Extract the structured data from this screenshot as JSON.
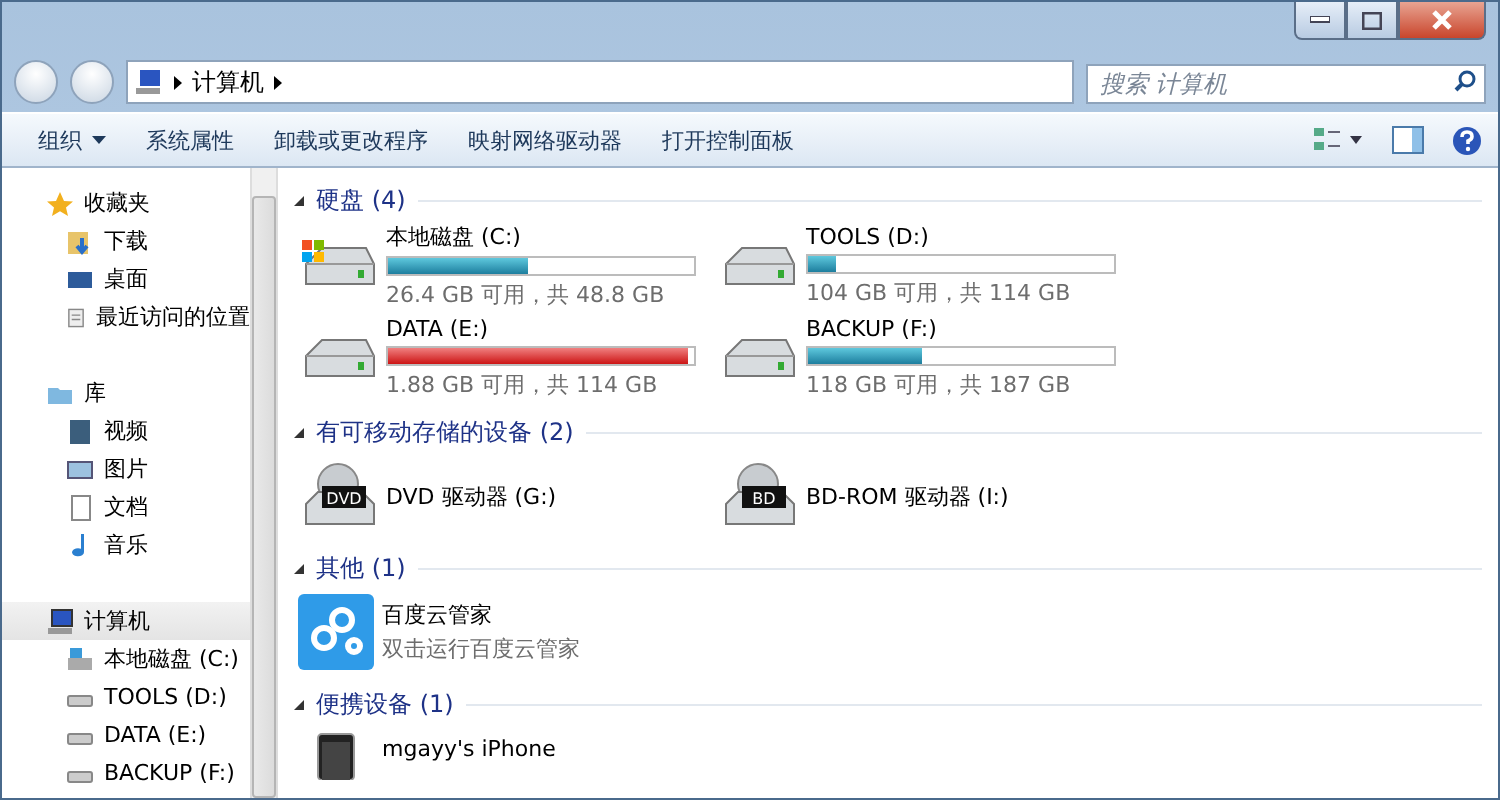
{
  "address": {
    "path": [
      {
        "label": "计算机"
      }
    ]
  },
  "search": {
    "placeholder": "搜索 计算机"
  },
  "toolbar": {
    "buttons": [
      {
        "label": "组织",
        "dropdown": true
      },
      {
        "label": "系统属性",
        "dropdown": false
      },
      {
        "label": "卸载或更改程序",
        "dropdown": false
      },
      {
        "label": "映射网络驱动器",
        "dropdown": false
      },
      {
        "label": "打开控制面板",
        "dropdown": false
      }
    ]
  },
  "sidebar": {
    "groups": [
      {
        "label": "收藏夹",
        "kind": "star",
        "selected": false,
        "children": [
          {
            "label": "下载",
            "kind": "download"
          },
          {
            "label": "桌面",
            "kind": "desktop"
          },
          {
            "label": "最近访问的位置",
            "kind": "recent"
          }
        ]
      },
      {
        "label": "库",
        "kind": "library",
        "selected": false,
        "children": [
          {
            "label": "视频",
            "kind": "video"
          },
          {
            "label": "图片",
            "kind": "picture"
          },
          {
            "label": "文档",
            "kind": "document"
          },
          {
            "label": "音乐",
            "kind": "music"
          }
        ]
      },
      {
        "label": "计算机",
        "kind": "computer",
        "selected": true,
        "children": [
          {
            "label": "本地磁盘 (C:)",
            "kind": "sysdrive"
          },
          {
            "label": "TOOLS (D:)",
            "kind": "drive"
          },
          {
            "label": "DATA (E:)",
            "kind": "drive"
          },
          {
            "label": "BACKUP (F:)",
            "kind": "drive"
          }
        ]
      }
    ]
  },
  "sections": [
    {
      "title": "硬盘 (4)",
      "items": [
        {
          "kind": "drive",
          "name": "本地磁盘 (C:)",
          "system": true,
          "level": 0.46,
          "low_space": false,
          "detail": "26.4 GB 可用，共 48.8 GB"
        },
        {
          "kind": "drive",
          "name": "TOOLS (D:)",
          "system": false,
          "level": 0.09,
          "low_space": false,
          "detail": "104 GB 可用，共 114 GB"
        },
        {
          "kind": "drive",
          "name": "DATA (E:)",
          "system": false,
          "level": 0.98,
          "low_space": true,
          "detail": "1.88 GB 可用，共 114 GB"
        },
        {
          "kind": "drive",
          "name": "BACKUP (F:)",
          "system": false,
          "level": 0.37,
          "low_space": false,
          "detail": "118 GB 可用，共 187 GB"
        }
      ]
    },
    {
      "title": "有可移动存储的设备 (2)",
      "items": [
        {
          "kind": "optical",
          "name": "DVD 驱动器 (G:)",
          "disc_label": "DVD"
        },
        {
          "kind": "optical",
          "name": "BD-ROM 驱动器 (I:)",
          "disc_label": "BD"
        }
      ]
    },
    {
      "title": "其他 (1)",
      "items": [
        {
          "kind": "app",
          "name": "百度云管家",
          "detail": "双击运行百度云管家"
        }
      ]
    },
    {
      "title": "便携设备 (1)",
      "items": [
        {
          "kind": "phone",
          "name": "mgayy's iPhone"
        }
      ]
    }
  ]
}
